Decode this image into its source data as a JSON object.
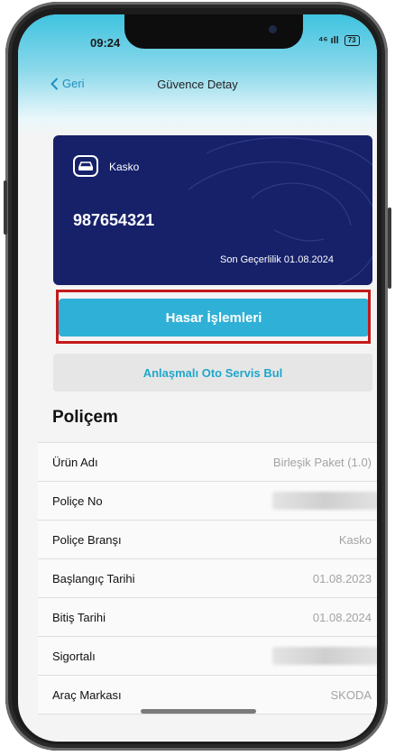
{
  "status_bar": {
    "time": "09:24",
    "signal": "⁴⁶ ıll",
    "battery": "73"
  },
  "nav": {
    "back_label": "Geri",
    "title": "Güvence Detay"
  },
  "card": {
    "type_label": "Kasko",
    "number": "987654321",
    "expiry": "Son Geçerlilik 01.08.2024",
    "icon": "car-icon"
  },
  "actions": {
    "primary_label": "Hasar İşlemleri",
    "secondary_label": "Anlaşmalı Oto Servis Bul"
  },
  "policy": {
    "section_title": "Poliçem",
    "rows": [
      {
        "label": "Ürün Adı",
        "value": "Birleşik Paket (1.0)"
      },
      {
        "label": "Poliçe No",
        "value": ""
      },
      {
        "label": "Poliçe Branşı",
        "value": "Kasko"
      },
      {
        "label": "Başlangıç Tarihi",
        "value": "01.08.2023"
      },
      {
        "label": "Bitiş Tarihi",
        "value": "01.08.2024"
      },
      {
        "label": "Sigortalı",
        "value": ""
      },
      {
        "label": "Araç Markası",
        "value": "SKODA"
      }
    ]
  },
  "colors": {
    "card_bg": "#16216a",
    "primary_button": "#2fb0d6",
    "accent_text": "#20a7cc",
    "highlight_border": "#c41a1a"
  }
}
